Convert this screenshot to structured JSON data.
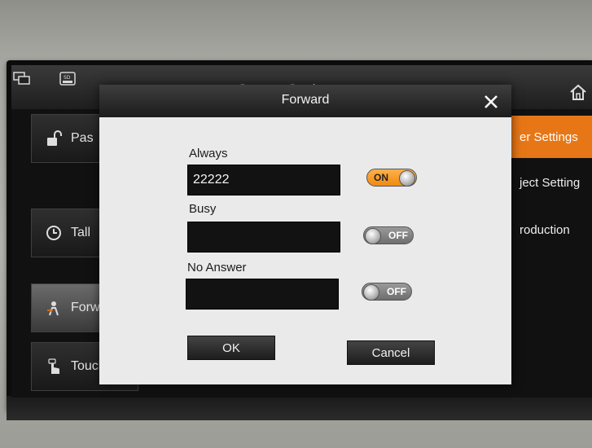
{
  "system_title": "System Settings",
  "left_menu": [
    {
      "label": "Pas",
      "icon": "lock-open-icon"
    },
    {
      "label": "Tall",
      "icon": "clock-icon"
    },
    {
      "label": "Forw",
      "icon": "forward-person-icon"
    },
    {
      "label": "Touch",
      "icon": "touch-hand-icon"
    }
  ],
  "right_menu": [
    {
      "label": "er Settings",
      "active": true
    },
    {
      "label": "ject Setting",
      "active": false
    },
    {
      "label": "roduction",
      "active": false
    }
  ],
  "dialog": {
    "title": "Forward",
    "fields": [
      {
        "label": "Always",
        "value": "22222",
        "toggle": "ON"
      },
      {
        "label": "Busy",
        "value": "",
        "toggle": "OFF"
      },
      {
        "label": "No Answer",
        "value": "",
        "toggle": "OFF"
      }
    ],
    "ok_label": "OK",
    "cancel_label": "Cancel"
  },
  "colors": {
    "accent": "#e77716",
    "toggle_on": "#f08a12",
    "field_bg": "#121212"
  }
}
